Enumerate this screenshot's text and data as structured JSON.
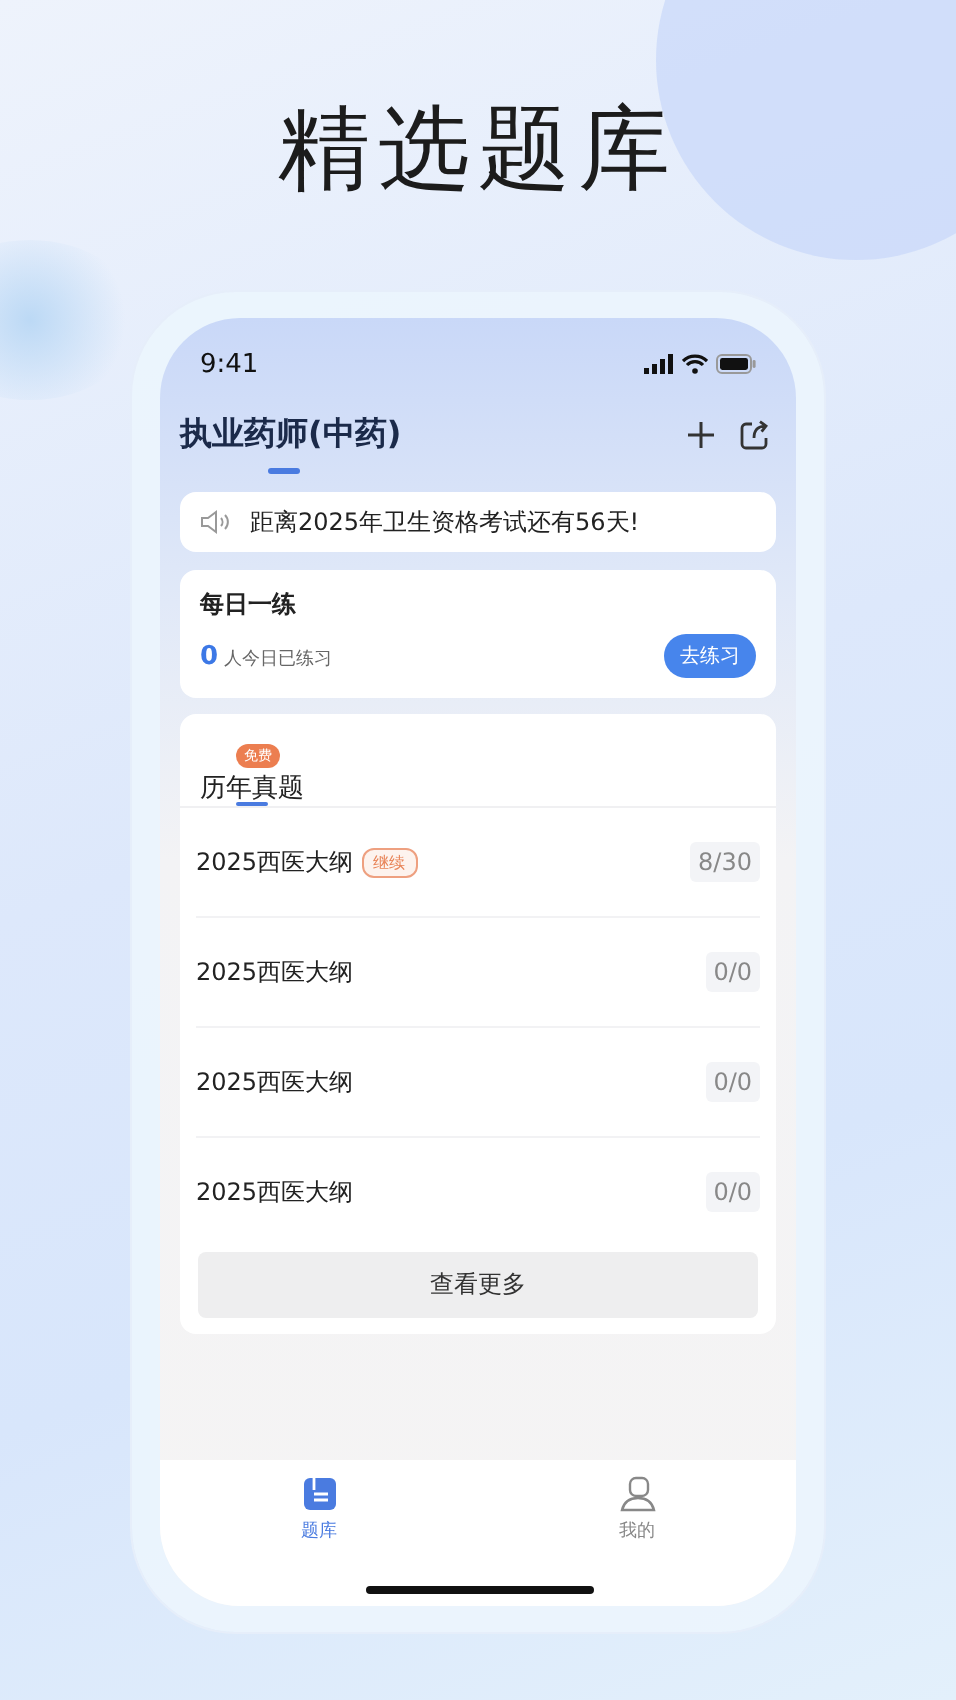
{
  "headline": "精选题库",
  "status_bar": {
    "time": "9:41"
  },
  "header": {
    "title": "执业药师(中药)"
  },
  "notice": {
    "text": "距离2025年卫生资格考试还有56天!"
  },
  "daily": {
    "title": "每日一练",
    "count": "0",
    "count_label": "人今日已练习",
    "button": "去练习"
  },
  "history": {
    "badge": "免费",
    "title": "历年真题",
    "rows": [
      {
        "name": "2025西医大纲",
        "tag": "继续",
        "progress": "8/30"
      },
      {
        "name": "2025西医大纲",
        "progress": "0/0"
      },
      {
        "name": "2025西医大纲",
        "progress": "0/0"
      },
      {
        "name": "2025西医大纲",
        "progress": "0/0"
      }
    ],
    "more_button": "查看更多"
  },
  "tab_bar": [
    {
      "label": "题库",
      "selected": true,
      "kind": "bank"
    },
    {
      "label": "我的",
      "selected": false,
      "kind": "profile"
    }
  ]
}
